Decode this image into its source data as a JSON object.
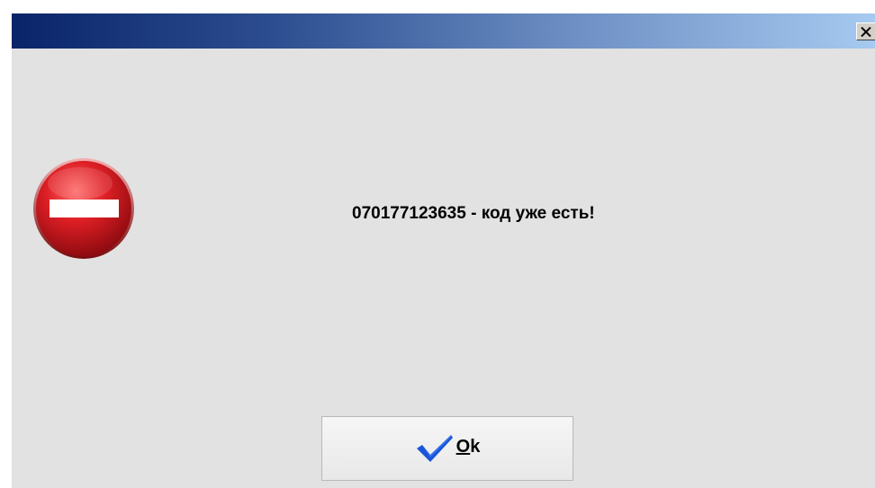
{
  "window": {
    "title": "",
    "close_icon": "close-icon"
  },
  "dialog": {
    "icon": "stop-icon",
    "message": "070177123635 - код уже есть!"
  },
  "buttons": {
    "ok": {
      "icon": "checkmark-icon",
      "mnemonic": "O",
      "rest": "k"
    }
  },
  "colors": {
    "titlebar_start": "#0a246a",
    "titlebar_end": "#a6caf0",
    "dialog_bg": "#e2e2e2",
    "stop_red": "#c8151b",
    "check_blue": "#1a55d8"
  }
}
